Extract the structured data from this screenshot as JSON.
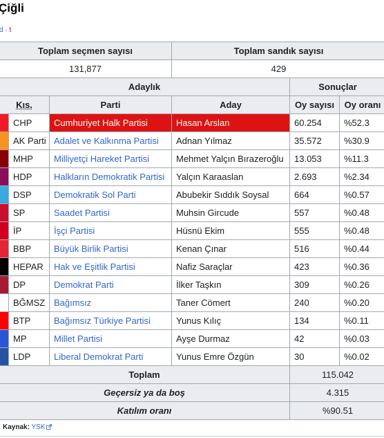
{
  "title": "Çiğli",
  "navbox": {
    "d": "d",
    "sep": " · ",
    "t": "t"
  },
  "totals": {
    "voters_label": "Toplam seçmen sayısı",
    "ballot_label": "Toplam sandık sayısı",
    "voters_value": "131,877",
    "ballot_value": "429"
  },
  "headers": {
    "candidacy": "Adaylık",
    "results": "Sonuçlar",
    "abbr": "Kıs.",
    "party": "Parti",
    "candidate": "Aday",
    "votes": "Oy sayısı",
    "share": "Oy oranı"
  },
  "rows": [
    {
      "color": "#ed1c24",
      "abbr": "CHP",
      "party": "Cumhuriyet Halk Partisi",
      "candidate": "Hasan Arslan",
      "votes": "60.254",
      "share": "%52.3"
    },
    {
      "color": "#f7941d",
      "abbr": "AK Parti",
      "party": "Adalet ve Kalkınma Partisi",
      "candidate": "Adnan Yılmaz",
      "votes": "35.572",
      "share": "%30.9"
    },
    {
      "color": "#870000",
      "abbr": "MHP",
      "party": "Milliyetçi Hareket Partisi",
      "candidate": "Mehmet Yalçın Bırazeroğlu",
      "votes": "13.053",
      "share": "%11.3"
    },
    {
      "color": "#8a0e5c",
      "abbr": "HDP",
      "party": "Halkların Demokratik Partisi",
      "candidate": "Yalçın Karaaslan",
      "votes": "2.693",
      "share": "%2.34"
    },
    {
      "color": "#3aa9e0",
      "abbr": "DSP",
      "party": "Demokratik Sol Parti",
      "candidate": "Abubekir Sıddık Soysal",
      "votes": "664",
      "share": "%0.57"
    },
    {
      "color": "#c8102e",
      "abbr": "SP",
      "party": "Saadet Partisi",
      "candidate": "Muhsin Gircude",
      "votes": "557",
      "share": "%0.48"
    },
    {
      "color": "#d1001f",
      "abbr": "İP",
      "party": "İşçi Partisi",
      "candidate": "Hüsnü Ekim",
      "votes": "555",
      "share": "%0.48"
    },
    {
      "color": "#e32636",
      "abbr": "BBP",
      "party": "Büyük Birlik Partisi",
      "candidate": "Kenan Çınar",
      "votes": "516",
      "share": "%0.44"
    },
    {
      "color": "#000000",
      "abbr": "HEPAR",
      "party": "Hak ve Eşitlik Partisi",
      "candidate": "Nafiz Saraçlar",
      "votes": "423",
      "share": "%0.36"
    },
    {
      "color": "#a51c30",
      "abbr": "DP",
      "party": "Demokrat Parti",
      "candidate": "İlker Taşkın",
      "votes": "309",
      "share": "%0.26"
    },
    {
      "color": "#ffffff",
      "abbr": "BĞMSZ",
      "party": "Bağımsız",
      "candidate": "Taner Cömert",
      "votes": "240",
      "share": "%0.20"
    },
    {
      "color": "#ff0000",
      "abbr": "BTP",
      "party": "Bağımsız Türkiye Partisi",
      "candidate": "Yunus Kılıç",
      "votes": "134",
      "share": "%0.11"
    },
    {
      "color": "#2b55d6",
      "abbr": "MP",
      "party": "Millet Partisi",
      "candidate": "Ayşe Durmaz",
      "votes": "42",
      "share": "%0.03"
    },
    {
      "color": "#2553a0",
      "abbr": "LDP",
      "party": "Liberal Demokrat Parti",
      "candidate": "Yunus Emre Özgün",
      "votes": "30",
      "share": "%0.02"
    }
  ],
  "summary": [
    {
      "label": "Toplam",
      "value": "115.042",
      "italic": false
    },
    {
      "label": "Geçersiz ya da boş",
      "value": "4.315",
      "italic": true
    },
    {
      "label": "Katılım oranı",
      "value": "%90.51",
      "italic": true
    }
  ],
  "source": {
    "label": "Kaynak:",
    "link": "YSK",
    "icon": "external-link-icon"
  }
}
